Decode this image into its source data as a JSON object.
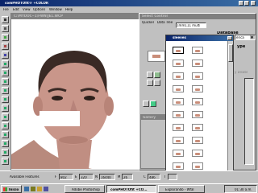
{
  "app": {
    "title": "comPHOTOfit® +COLOR",
    "menu": [
      "File",
      "Edit",
      "View",
      "Options",
      "Window",
      "Help"
    ]
  },
  "doc": {
    "title": "C:\\MYDOC~1\\FWN\\JE1.WCP"
  },
  "select_control": {
    "title": "Select Control",
    "menu": [
      "Quicker",
      "Data Tree"
    ],
    "selections_label": "Selections",
    "selection_value": "[mm111 multi",
    "database_label": "Database",
    "database_value": "erica",
    "type_label": "ype",
    "disabled_label": "y Disabl"
  },
  "gallery": {
    "title": "Gallery"
  },
  "popup": {
    "title": "sleeves"
  },
  "status": {
    "text": "Available Features",
    "f_label": "F",
    "f_value": "802",
    "e_value": "320",
    "n_value": "16440",
    "m_label": "M",
    "m_value": "26",
    "c_label": "C",
    "c_value": "486",
    "t_label": "T"
  },
  "taskbar": {
    "start": "Inicio",
    "items": [
      "Adobe Photoshop",
      "comPHOTOfit +CO...",
      "Explorando - Wfal"
    ],
    "clock": "01:30 a.m."
  },
  "colors": {
    "title_active": "#0a246a",
    "face_skin": "#c9968a",
    "mask": "#ffffff",
    "window_gray": "#c0c0c0"
  }
}
